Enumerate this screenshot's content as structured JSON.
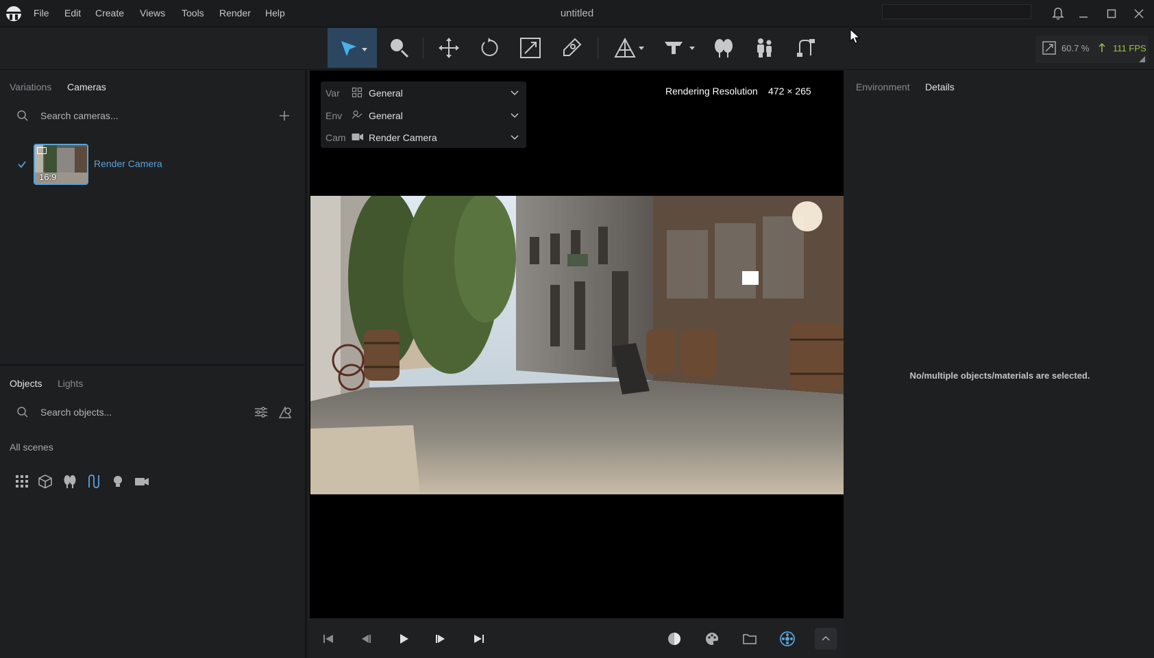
{
  "colors": {
    "accent": "#5aa3d8",
    "fps_green": "#9bc24a",
    "active_tool_bg": "#2c4660",
    "panel_bg": "#1e1f21"
  },
  "menu": {
    "items": [
      "File",
      "Edit",
      "Create",
      "Views",
      "Tools",
      "Render",
      "Help"
    ]
  },
  "window": {
    "title": "untitled"
  },
  "toolbar": {
    "tools": [
      "select-tool",
      "material-picker-tool",
      "move-tool",
      "rotate-tool",
      "scale-tool",
      "pivot-tool",
      "camera-perspective-tool",
      "render-area-tool",
      "nature-tool",
      "people-tool",
      "path-tool"
    ],
    "active_tool": "select-tool",
    "zoom": "60.7 %",
    "fps": "111 FPS"
  },
  "left_panel": {
    "camera_tabs": [
      "Variations",
      "Cameras"
    ],
    "active_camera_tab": "Cameras",
    "camera_search_placeholder": "Search cameras...",
    "cameras": [
      {
        "name": "Render Camera",
        "ratio": "16:9",
        "selected": true
      }
    ],
    "object_tabs": [
      "Objects",
      "Lights"
    ],
    "active_object_tab": "Objects",
    "object_search_placeholder": "Search objects...",
    "scenes_label": "All scenes",
    "filter_icons": [
      "grid-icon",
      "cube-icon",
      "nature-icon",
      "path-icon",
      "light-bulb-icon",
      "camera-icon"
    ]
  },
  "viewport": {
    "overlay": {
      "var_label": "Var",
      "var_value": "General",
      "env_label": "Env",
      "env_value": "General",
      "cam_label": "Cam",
      "cam_value": "Render Camera"
    },
    "resolution_label": "Rendering Resolution",
    "resolution_value": "472 × 265"
  },
  "bottom_bar": {
    "playback": [
      "skip-to-start-icon",
      "step-back-icon",
      "play-icon",
      "step-forward-icon",
      "skip-to-end-icon"
    ],
    "tools": [
      "sphere-icon",
      "palette-icon",
      "folder-icon",
      "render-settings-icon",
      "chevron-up-icon"
    ]
  },
  "right_panel": {
    "tabs": [
      "Environment",
      "Details"
    ],
    "active_tab": "Details",
    "empty_message": "No/multiple objects/materials are selected."
  }
}
